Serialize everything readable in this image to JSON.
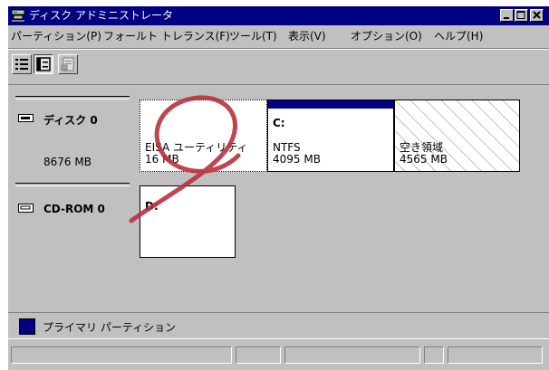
{
  "window": {
    "title": "ディスク アドミニストレータ"
  },
  "menu": [
    {
      "label": "パーティション(P)"
    },
    {
      "label": "フォールト トレランス(F)"
    },
    {
      "label": "ツール(T)"
    },
    {
      "label": "表示(V)"
    },
    {
      "label": "オプション(O)"
    },
    {
      "label": "ヘルプ(H)"
    }
  ],
  "toolbar": {
    "icons": [
      "volume-view-icon",
      "disk-configuration-view-icon",
      "properties-icon"
    ],
    "selected": "disk-configuration-view-icon"
  },
  "disks": [
    {
      "label": "ディスク 0",
      "size": "8676 MB",
      "partitions": [
        {
          "line1": "",
          "line2": "EISA ユーティリティ",
          "line3": "16 MB",
          "selected": true
        },
        {
          "line1": "C:",
          "line2": "NTFS",
          "line3": "4095 MB",
          "primary": true
        },
        {
          "line1": "",
          "line2": "空き領域",
          "line3": "4565 MB",
          "free": true
        }
      ]
    },
    {
      "label": "CD-ROM 0",
      "size": "",
      "partitions": [
        {
          "line1": "D:"
        }
      ]
    }
  ],
  "legend": {
    "label": "プライマリ パーティション",
    "color": "#000080"
  },
  "colors": {
    "titlebar": "#000080",
    "face": "#c0c0c0",
    "annotation": "#b8323e"
  }
}
